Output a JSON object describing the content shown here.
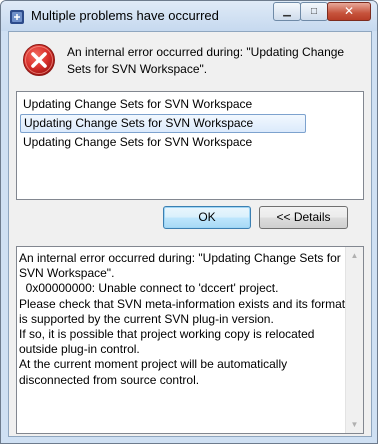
{
  "window": {
    "title": "Multiple problems have occurred",
    "minimize_glyph": "▁",
    "maximize_glyph": "□",
    "close_glyph": "✕"
  },
  "icons": {
    "app": "eclipse-app-icon",
    "error": "error-circle-x-icon"
  },
  "message": "An internal error occurred during: \"Updating Change Sets for SVN Workspace\".",
  "problems": [
    {
      "label": "Updating Change Sets for SVN Workspace",
      "selected": false
    },
    {
      "label": "Updating Change Sets for SVN Workspace",
      "selected": true
    },
    {
      "label": "Updating Change Sets for SVN Workspace",
      "selected": false
    }
  ],
  "buttons": {
    "ok": "OK",
    "details": "<< Details"
  },
  "details_text": "An internal error occurred during: \"Updating Change Sets for SVN Workspace\".\n  0x00000000: Unable connect to 'dccert' project.\nPlease check that SVN meta-information exists and its format is supported by the current SVN plug-in version.\nIf so, it is possible that project working copy is relocated outside plug-in control.\nAt the current moment project will be automatically disconnected from source control.",
  "colors": {
    "error_red": "#d9302c",
    "selection_border": "#7da2ce",
    "ok_button_border": "#3c7fb1"
  }
}
